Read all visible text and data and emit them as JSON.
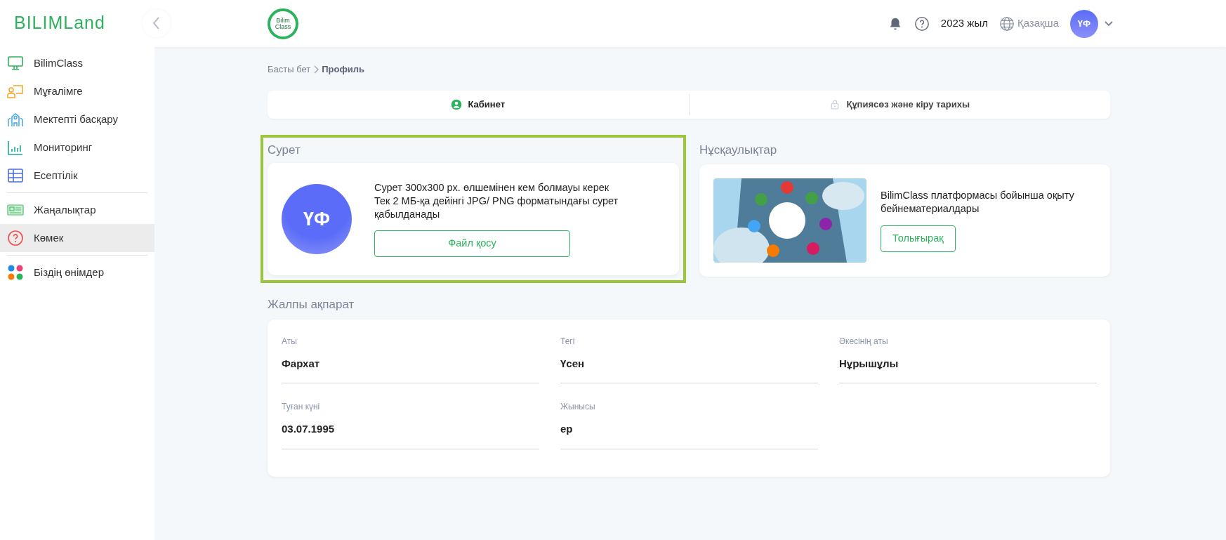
{
  "sidebar": {
    "logo": "BILIMLand",
    "items": [
      {
        "label": "BilimClass",
        "selected": false,
        "divider_after": false
      },
      {
        "label": "Мұғалімге",
        "selected": false,
        "divider_after": false
      },
      {
        "label": "Мектепті басқару",
        "selected": false,
        "divider_after": false
      },
      {
        "label": "Мониторинг",
        "selected": false,
        "divider_after": false
      },
      {
        "label": "Есептілік",
        "selected": false,
        "divider_after": true
      },
      {
        "label": "Жаңалықтар",
        "selected": false,
        "divider_after": false
      },
      {
        "label": "Көмек",
        "selected": true,
        "divider_after": true
      },
      {
        "label": "Біздің өнімдер",
        "selected": false,
        "divider_after": false
      }
    ]
  },
  "header": {
    "app_logo": [
      "Bilim",
      "Class"
    ],
    "year": "2023 жыл",
    "language": "Қазақша",
    "avatar": "ҮФ"
  },
  "breadcrumb": [
    {
      "label": "Басты бет",
      "current": false
    },
    {
      "label": "Профиль",
      "current": true
    }
  ],
  "tabs": [
    {
      "label": "Кабинет",
      "selected": true
    },
    {
      "label": "Құпиясөз және кіру тарихы",
      "selected": false
    }
  ],
  "photo_section": {
    "title": "Сурет",
    "highlighted": true,
    "avatar": "ҮФ",
    "lines": [
      "Сурет 300x300 px. өлшемінен кем болмауы керек",
      "Тек 2 МБ-қа дейінгі JPG/ PNG форматындағы сурет қабылданады"
    ],
    "button": "Файл қосу"
  },
  "guides_section": {
    "title": "Нұсқаулықтар",
    "text": "BilimClass платформасы бойынша оқыту бейнематериалдары",
    "button": "Толығырақ"
  },
  "general_section": {
    "title": "Жалпы ақпарат",
    "fields": [
      {
        "label": "Аты",
        "value": "Фархат"
      },
      {
        "label": "Тегі",
        "value": "Үсен"
      },
      {
        "label": "Әкесінің аты",
        "value": "Нұрышұлы"
      },
      {
        "label": "Туған күні",
        "value": "03.07.1995"
      },
      {
        "label": "Жынысы",
        "value": "ер"
      }
    ]
  }
}
